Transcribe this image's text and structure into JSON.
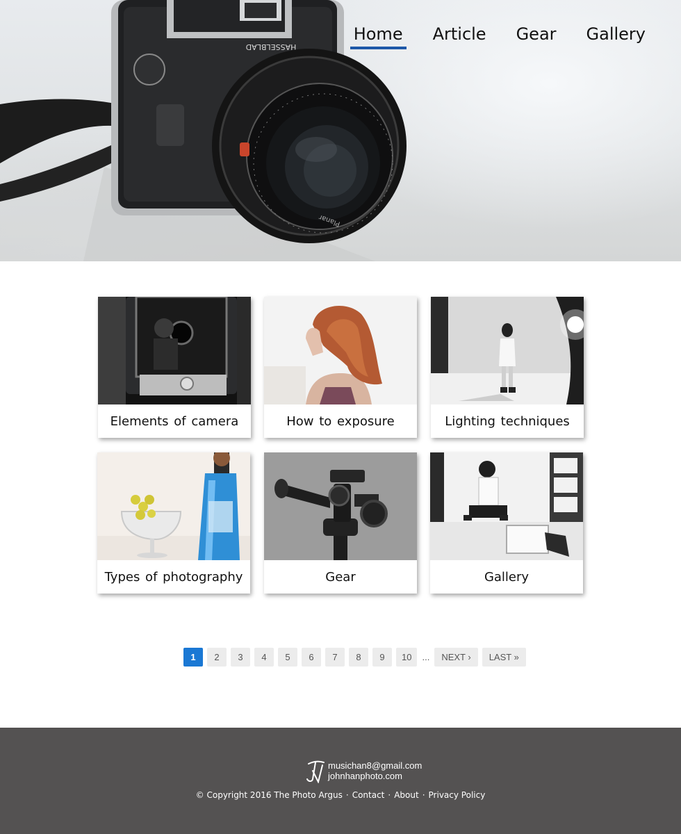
{
  "nav": {
    "items": [
      {
        "label": "Home",
        "active": true
      },
      {
        "label": "Article",
        "active": false
      },
      {
        "label": "Gear",
        "active": false
      },
      {
        "label": "Gallery",
        "active": false
      }
    ],
    "active_color": "#1d58a8"
  },
  "hero": {
    "camera_nameplate": "HASSELBLAD",
    "lens_brand": "Planar"
  },
  "cards": [
    {
      "title": "Elements of camera",
      "image": "camera-viewfinder-photo"
    },
    {
      "title": "How to exposure",
      "image": "red-haired-woman-photo"
    },
    {
      "title": "Lighting techniques",
      "image": "studio-model-photo"
    },
    {
      "title": "Types of photography",
      "image": "still-life-glass-photo"
    },
    {
      "title": "Gear",
      "image": "tripod-head-photo"
    },
    {
      "title": "Gallery",
      "image": "studio-portrait-photo"
    }
  ],
  "pagination": {
    "current": "1",
    "pages": [
      "2",
      "3",
      "4",
      "5",
      "6",
      "7",
      "8",
      "9",
      "10"
    ],
    "ellipsis": "...",
    "next": "NEXT ›",
    "last": "LAST »",
    "current_color": "#1a78d4"
  },
  "footer": {
    "email": "musichan8@gmail.com",
    "website": "johnhanphoto.com",
    "copyright": "© Copyright 2016 The Photo Argus",
    "separator": "·",
    "links": [
      "Contact",
      "About",
      "Privacy Policy"
    ],
    "background": "#545252"
  }
}
